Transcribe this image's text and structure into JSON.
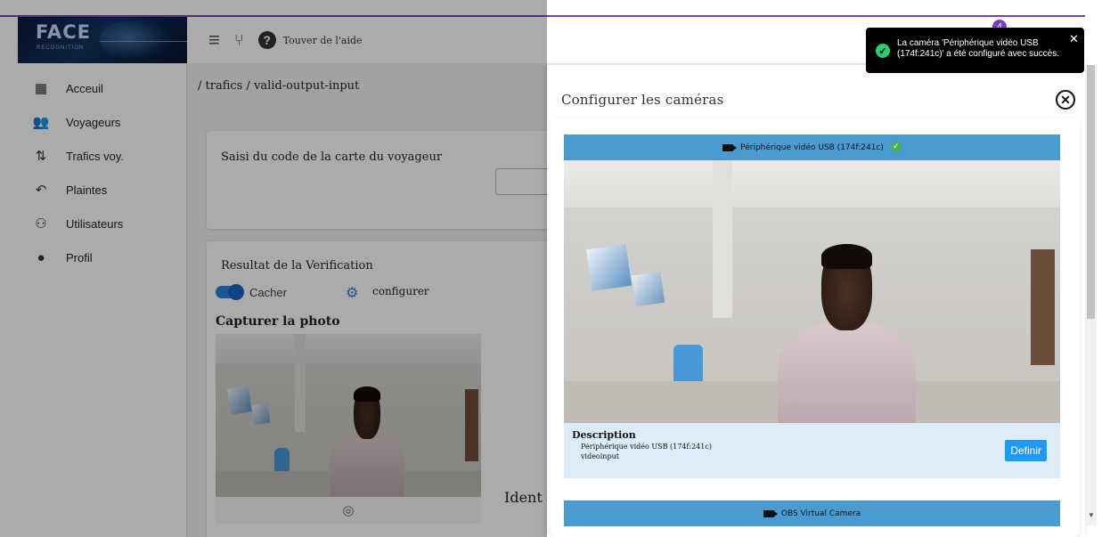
{
  "logo": {
    "text": "FACE",
    "subtext": "RECOGNITION"
  },
  "topbar": {
    "help_label": "Touver de l'aide",
    "notification_count": "4"
  },
  "sidebar": {
    "items": [
      {
        "label": "Acceuil",
        "icon": "dashboard-icon"
      },
      {
        "label": "Voyageurs",
        "icon": "people-icon"
      },
      {
        "label": "Trafics voy.",
        "icon": "traffic-icon"
      },
      {
        "label": "Plaintes",
        "icon": "complaint-icon"
      },
      {
        "label": "Utilisateurs",
        "icon": "users-icon"
      },
      {
        "label": "Profil",
        "icon": "profile-icon"
      }
    ]
  },
  "main": {
    "breadcrumb": "/ trafics / valid-output-input",
    "card_code_title": "Saisi du code de la carte du voyageur",
    "verification_title": "Resultat de la Verification",
    "toggle_label": "Cacher",
    "configure_label": "configurer",
    "photo_title": "Capturer la photo",
    "identity_label": "Ident"
  },
  "drawer": {
    "title": "Configurer les caméras",
    "cameras": [
      {
        "name": "Périphérique vidéo USB (174f:241c)",
        "description_label": "Description",
        "description_name": "Périphérique vidéo USB (174f:241c)",
        "kind": "videoinput",
        "define_label": "Definir"
      },
      {
        "name": "OBS Virtual Camera"
      }
    ]
  },
  "toast": {
    "message": "La caméra 'Périphérique vidéo USB (174f:241c)' a été configuré avec succès."
  },
  "colors": {
    "accent": "#7a3fc0",
    "camera_header": "#4a9bd2",
    "define_button": "#1e9bf0",
    "success": "#2ecc71"
  }
}
